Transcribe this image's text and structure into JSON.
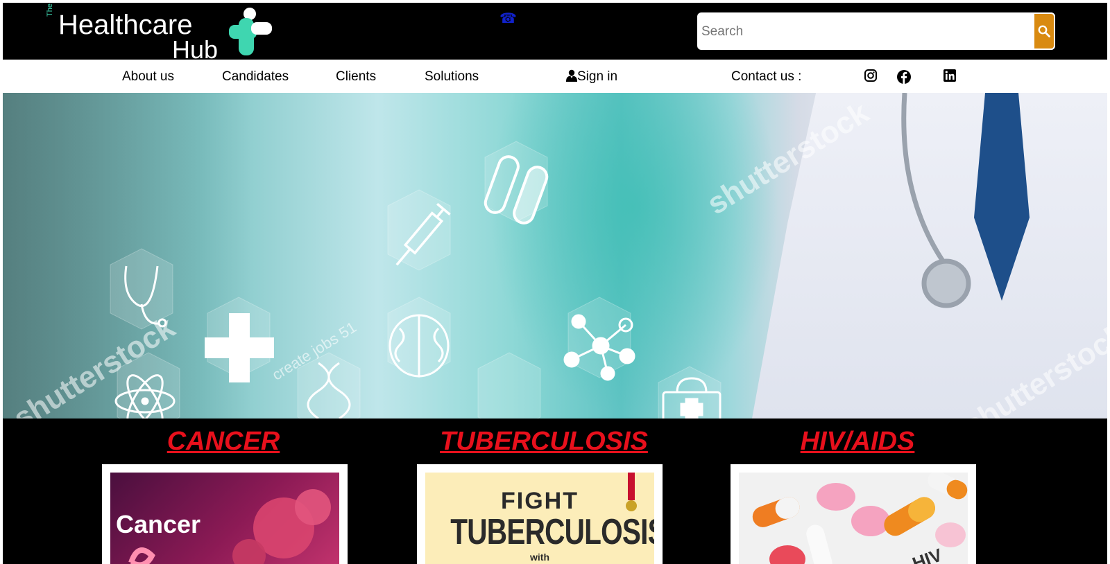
{
  "header": {
    "logo": {
      "the": "The",
      "word1": "Healthcare",
      "word2": "Hub"
    },
    "phone_icon": "☎",
    "search": {
      "placeholder": "Search",
      "value": ""
    },
    "colors": {
      "accent_teal": "#3fd6b0",
      "search_button": "#d98a10"
    }
  },
  "nav": {
    "items": [
      {
        "label": "About us"
      },
      {
        "label": "Candidates"
      },
      {
        "label": "Clients"
      },
      {
        "label": "Solutions"
      }
    ],
    "sign_in": "Sign in",
    "contact": "Contact us :",
    "social": [
      "instagram-icon",
      "facebook-icon",
      "linkedin-icon"
    ]
  },
  "hero": {
    "watermark": "shutterstock",
    "caption": "create jobs 51"
  },
  "cards": [
    {
      "title": "CANCER",
      "image_text": "Cancer"
    },
    {
      "title": "TUBERCULOSIS",
      "image_text": [
        "FIGHT",
        "TUBERCULOSIS",
        "with"
      ]
    },
    {
      "title": "HIV/AIDS",
      "image_text": "HIV"
    }
  ]
}
